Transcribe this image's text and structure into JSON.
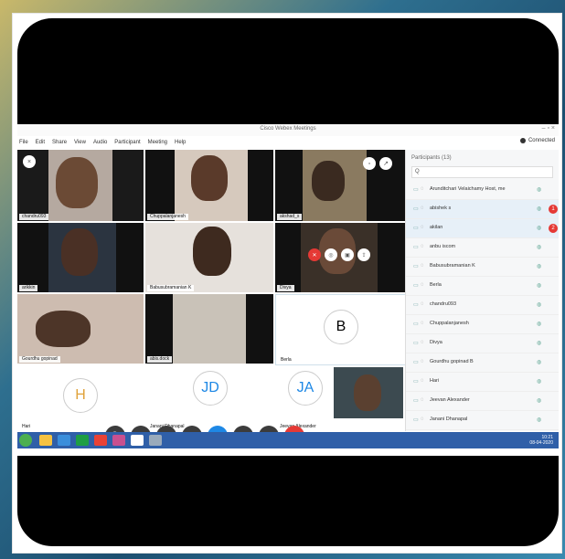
{
  "window": {
    "title": "Cisco Webex Meetings",
    "controls": "–  ▫  ×"
  },
  "menu": [
    "File",
    "Edit",
    "Share",
    "View",
    "Audio",
    "Participant",
    "Meeting",
    "Help"
  ],
  "connection": {
    "label": "Connected"
  },
  "tiles": [
    {
      "label": "chandru093"
    },
    {
      "label": "Chuppalanjanesh"
    },
    {
      "label": "akshad_s"
    },
    {
      "label": "arikkin"
    },
    {
      "label": "Babusubramanian K"
    },
    {
      "label": "Divya"
    },
    {
      "label": "Gourdhu gopinad"
    },
    {
      "label": "abis.dock"
    },
    {
      "label": "Berla",
      "initial": "B"
    },
    {
      "label": "Hari",
      "initial": "H"
    },
    {
      "label": "Janani Dhanapal",
      "initial": "JD"
    },
    {
      "label": "Jeevan Alexander",
      "initial": "JA"
    }
  ],
  "panel": {
    "header": "Participants (13)",
    "search_icon": "Q",
    "participants": [
      {
        "name": "Arunditchari Velaichamy Host, me",
        "badge": ""
      },
      {
        "name": "abishek s",
        "badge": "1"
      },
      {
        "name": "akilan",
        "badge": "2"
      },
      {
        "name": "anbu iscom",
        "badge": ""
      },
      {
        "name": "Babusubramanian K",
        "badge": ""
      },
      {
        "name": "Berla",
        "badge": ""
      },
      {
        "name": "chandru093",
        "badge": ""
      },
      {
        "name": "Chuppalanjanesh",
        "badge": ""
      },
      {
        "name": "Divya",
        "badge": ""
      },
      {
        "name": "Gourdhu gopinad B",
        "badge": ""
      },
      {
        "name": "Hari",
        "badge": ""
      },
      {
        "name": "Jeevan Alexander",
        "badge": ""
      },
      {
        "name": "Janani Dhanapal",
        "badge": ""
      }
    ]
  },
  "taskbar": {
    "time": "10:21",
    "date": "08-04-2020"
  }
}
